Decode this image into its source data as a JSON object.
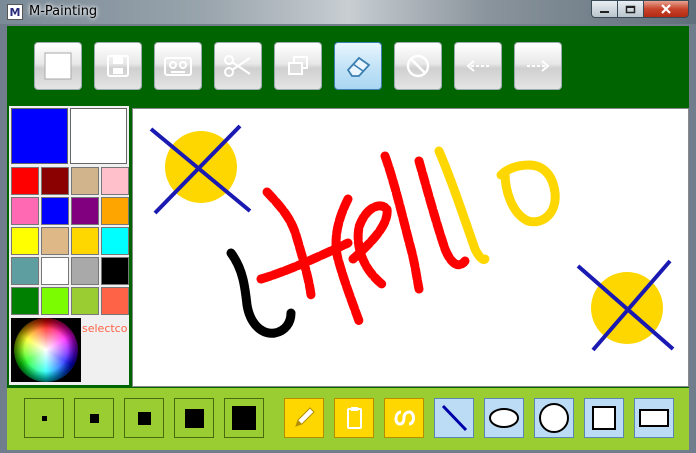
{
  "window": {
    "title": "M-Painting",
    "app_icon_letter": "M"
  },
  "palette": {
    "primary_color": "#0000ff",
    "secondary_color": "#ffffff",
    "swatches": [
      "#ff0000",
      "#8b0000",
      "#d2b48c",
      "#ffc0cb",
      "#ff69b4",
      "#0000ff",
      "#800080",
      "#ffa500",
      "#ffff00",
      "#deb887",
      "#ffd700",
      "#00ffff",
      "#5f9ea0",
      "#ffffff",
      "#a9a9a9",
      "#000000",
      "#008000",
      "#7cfc00",
      "#9acd32",
      "#ff6347"
    ],
    "select_color_label": "selectcolor"
  },
  "toolbar_top": [
    {
      "name": "new-icon"
    },
    {
      "name": "save-icon"
    },
    {
      "name": "cassette-icon"
    },
    {
      "name": "cut-icon"
    },
    {
      "name": "copy-window-icon"
    },
    {
      "name": "eraser-icon",
      "active": true
    },
    {
      "name": "cancel-icon"
    },
    {
      "name": "arrow-left-icon"
    },
    {
      "name": "arrow-right-icon"
    }
  ],
  "toolbar_bottom": {
    "sizes": [
      {
        "name": "size-1"
      },
      {
        "name": "size-2"
      },
      {
        "name": "size-3"
      },
      {
        "name": "size-4"
      },
      {
        "name": "size-5"
      }
    ],
    "tools": [
      {
        "name": "pencil-icon"
      },
      {
        "name": "clipboard-icon"
      },
      {
        "name": "script-tool-icon"
      }
    ],
    "shapes": [
      {
        "name": "line-icon"
      },
      {
        "name": "ellipse-icon"
      },
      {
        "name": "circle-icon"
      },
      {
        "name": "square-icon"
      },
      {
        "name": "rectangle-icon"
      }
    ]
  },
  "colors": {
    "frame_green": "#006400",
    "bottom_bar": "#9acd32",
    "active_blue": "#3c7fb1"
  }
}
